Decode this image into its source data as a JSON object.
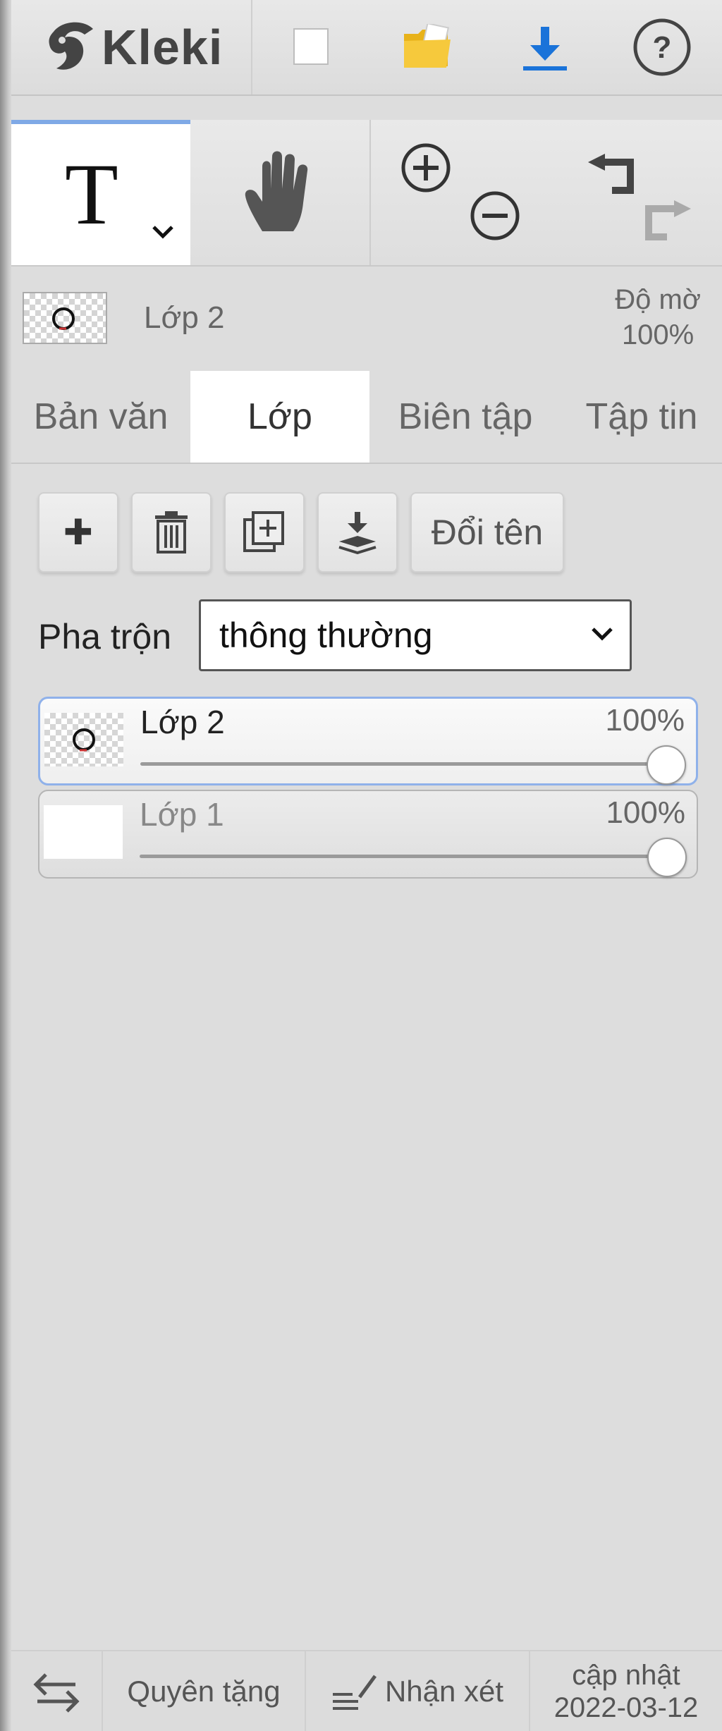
{
  "app": {
    "logo_text": "Kleki"
  },
  "header": {
    "icons": [
      "new-image-icon",
      "open-folder-icon",
      "download-icon",
      "help-icon"
    ],
    "colors": {
      "folder": "#f2c034",
      "download": "#1a73d9"
    }
  },
  "tools": {
    "text_tool_glyph": "T",
    "active_tool": "text"
  },
  "layer_preview": {
    "name": "Lớp 2",
    "opacity_label": "Độ mờ",
    "opacity_value": "100%"
  },
  "tabs": [
    {
      "label": "Bản văn",
      "active": false
    },
    {
      "label": "Lớp",
      "active": true
    },
    {
      "label": "Biên tập",
      "active": false
    },
    {
      "label": "Tập tin",
      "active": false
    }
  ],
  "layer_actions": {
    "add_glyph": "✚",
    "rename_label": "Đổi tên"
  },
  "blend": {
    "label": "Pha trộn",
    "selected": "thông thường"
  },
  "layers": [
    {
      "name": "Lớp 2",
      "opacity": "100%",
      "opacity_value": 1.0,
      "selected": true
    },
    {
      "name": "Lớp 1",
      "opacity": "100%",
      "opacity_value": 1.0,
      "selected": false
    }
  ],
  "footer": {
    "donate": "Quyên tặng",
    "feedback": "Nhận xét",
    "update_label": "cập nhật",
    "update_date": "2022-03-12"
  }
}
